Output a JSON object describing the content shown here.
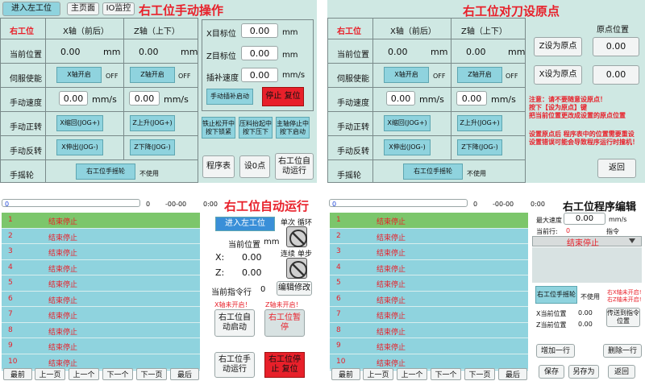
{
  "p1": {
    "title": "右工位手动操作",
    "nav": [
      "进入左工位",
      "主页面",
      "IO监控"
    ],
    "headers": [
      "右工位",
      "X轴（前后）",
      "Z轴（上下）"
    ],
    "rows": {
      "pos": {
        "label": "当前位置",
        "x_val": "0.00",
        "x_unit": "mm",
        "z_val": "0.00",
        "z_unit": "mm"
      },
      "servo": {
        "label": "伺服使能",
        "x_btn": "X轴开启",
        "x_state": "OFF",
        "z_btn": "Z轴开启",
        "z_state": "OFF"
      },
      "speed": {
        "label": "手动速度",
        "x_val": "0.00",
        "x_unit": "mm/s",
        "z_val": "0.00",
        "z_unit": "mm/s"
      },
      "fwd": {
        "label": "手动正转",
        "x_btn": "X缩回(JOG+)",
        "z_btn": "Z上升(JOG+)"
      },
      "rev": {
        "label": "手动反转",
        "x_btn": "X伸出(JOG-)",
        "z_btn": "Z下降(JOG-)"
      },
      "wheel": {
        "label": "手摇轮",
        "btn": "右工位手摇轮",
        "state": "不使用"
      }
    },
    "target": {
      "x_label": "X目标位",
      "x_val": "0.00",
      "x_unit": "mm",
      "z_label": "Z目标位",
      "z_val": "0.00",
      "z_unit": "mm",
      "speed_label": "插补速度",
      "speed_val": "0.00",
      "speed_unit": "mm/s"
    },
    "interp_btn": "手动插补启动",
    "stop_btn": "停止 复位",
    "small_btns": [
      "铁止松开中按下锁紧",
      "压料抬起中按下压下",
      "主轴停止中按下启动"
    ],
    "bottom_btns": [
      "程序表",
      "设0点",
      "右工位自动运行"
    ]
  },
  "p2": {
    "title": "右工位对刀设原点",
    "headers": [
      "右工位",
      "X轴（前后）",
      "Z轴（上下）"
    ],
    "origin_header": "原点位置",
    "rows": {
      "pos": {
        "label": "当前位置",
        "x_val": "0.00",
        "x_unit": "mm",
        "z_val": "0.00",
        "z_unit": "mm"
      },
      "servo": {
        "label": "伺服使能",
        "x_btn": "X轴开启",
        "x_state": "OFF",
        "z_btn": "Z轴开启",
        "z_state": "OFF"
      },
      "speed": {
        "label": "手动速度",
        "x_val": "0.00",
        "x_unit": "mm/s",
        "z_val": "0.00",
        "z_unit": "mm/s"
      },
      "fwd": {
        "label": "手动正转",
        "x_btn": "X缩回(JOG+)",
        "z_btn": "Z上升(JOG+)"
      },
      "rev": {
        "label": "手动反转",
        "x_btn": "X伸出(JOG-)",
        "z_btn": "Z下降(JOG-)"
      },
      "wheel": {
        "label": "手摇轮",
        "btn": "右工位手摇轮",
        "state": "不使用"
      }
    },
    "z_origin_btn": "Z设为原点",
    "z_origin_val": "0.00",
    "x_origin_btn": "X设为原点",
    "x_origin_val": "0.00",
    "note1": [
      "注意：请不要随意设原点！",
      "按下【设为原点】键",
      "把当前位置更改成设置的原点位置"
    ],
    "note2": [
      "设置原点后 程序表中的位置需要重设",
      "设置错误可能会导致程序运行时撞机！"
    ],
    "back_btn": "返回"
  },
  "p3": {
    "title": "右工位自动运行",
    "bar_val": "0",
    "bar_num": "0",
    "time": "-00-00",
    "time2": "0:00",
    "rows": [
      {
        "n": "1",
        "t": "结束停止"
      },
      {
        "n": "2",
        "t": "结束停止"
      },
      {
        "n": "3",
        "t": "结束停止"
      },
      {
        "n": "4",
        "t": "结束停止"
      },
      {
        "n": "5",
        "t": "结束停止"
      },
      {
        "n": "6",
        "t": "结束停止"
      },
      {
        "n": "7",
        "t": "结束停止"
      },
      {
        "n": "8",
        "t": "结束停止"
      },
      {
        "n": "9",
        "t": "结束停止"
      },
      {
        "n": "10",
        "t": "结束停止"
      }
    ],
    "nav": [
      "最前",
      "上一页",
      "上一个",
      "下一个",
      "下一页",
      "最后"
    ],
    "enter_left": "进入左工位",
    "single": "单次",
    "loop": "循环",
    "cont": "连续",
    "step": "单步",
    "pos_label": "当前位置",
    "pos_unit": "mm",
    "x_label": "X:",
    "x_val": "0.00",
    "z_label": "Z:",
    "z_val": "0.00",
    "cur_cmd_label": "当前指令行",
    "cur_cmd_val": "0",
    "edit_btn": "编辑修改",
    "x_warn": "X轴未开启！",
    "z_warn": "Z轴未开启！",
    "auto_start": "右工位自动启动",
    "pause": "右工位暂停",
    "manual": "右工位手动运行",
    "stop": "右工位停止 复位"
  },
  "p4": {
    "title": "右工位程序编辑",
    "bar_val": "0",
    "bar_num": "0",
    "time": "-00-00",
    "time2": "0:00",
    "rows": [
      {
        "n": "1",
        "t": "结束停止"
      },
      {
        "n": "2",
        "t": "结束停止"
      },
      {
        "n": "3",
        "t": "结束停止"
      },
      {
        "n": "4",
        "t": "结束停止"
      },
      {
        "n": "5",
        "t": "结束停止"
      },
      {
        "n": "6",
        "t": "结束停止"
      },
      {
        "n": "7",
        "t": "结束停止"
      },
      {
        "n": "8",
        "t": "结束停止"
      },
      {
        "n": "9",
        "t": "结束停止"
      },
      {
        "n": "10",
        "t": "结束停止"
      }
    ],
    "nav": [
      "最前",
      "上一页",
      "上一个",
      "下一个",
      "下一页",
      "最后"
    ],
    "max_speed_label": "最大速度",
    "max_speed_val": "0.00",
    "max_speed_unit": "mm/s",
    "cur_row_label": "当前行:",
    "cur_row_val": "0",
    "cmd_label": "指令",
    "select_val": "结束停止",
    "wheel_btn": "右工位手摇轮",
    "wheel_state": "不使用",
    "warn": [
      "右X轴未开启!",
      "右Z轴未开启!"
    ],
    "x_pos_label": "X当前位置",
    "x_pos_val": "0.00",
    "z_pos_label": "Z当前位置",
    "z_pos_val": "0.00",
    "send_btn": "传送到指令位置",
    "add_btn": "增加一行",
    "del_btn": "删除一行",
    "save_btn": "保存",
    "saveas_btn": "另存为",
    "back_btn": "返回"
  }
}
